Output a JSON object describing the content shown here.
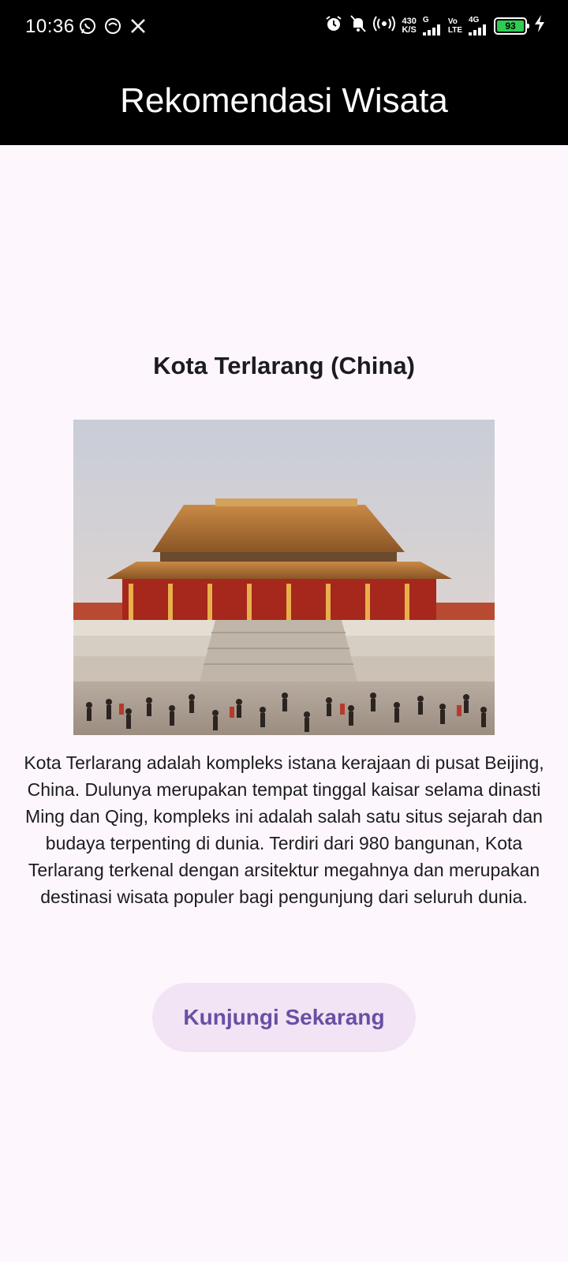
{
  "status_bar": {
    "time": "10:36",
    "net_speed_value": "430",
    "net_speed_unit": "K/S",
    "signal_1_label": "G",
    "volte_top": "Vo",
    "volte_bottom": "LTE",
    "signal_2_label": "4G",
    "battery_level": "93",
    "icons": [
      "whatsapp-icon",
      "chat-bubble-icon",
      "x-icon",
      "alarm-icon",
      "bell-muted-icon",
      "hotspot-icon",
      "signal-icon",
      "signal-icon",
      "battery-icon",
      "charging-bolt-icon"
    ]
  },
  "app_bar": {
    "title": "Rekomendasi Wisata"
  },
  "destination": {
    "name": "Kota Terlarang (China)",
    "description": "Kota Terlarang adalah kompleks istana kerajaan di pusat Beijing, China. Dulunya merupakan tempat tinggal kaisar selama dinasti Ming dan Qing, kompleks ini adalah salah satu situs sejarah dan budaya terpenting di dunia. Terdiri dari 980 bangunan, Kota Terlarang terkenal dengan arsitektur megahnya dan merupakan destinasi wisata populer bagi pengunjung dari seluruh dunia.",
    "action_label": "Kunjungi Sekarang"
  },
  "colors": {
    "app_bar_bg": "#000000",
    "page_bg": "#fdf7fd",
    "button_bg": "#f2e4f4",
    "button_text": "#6750a4",
    "battery": "#2ecc52"
  }
}
